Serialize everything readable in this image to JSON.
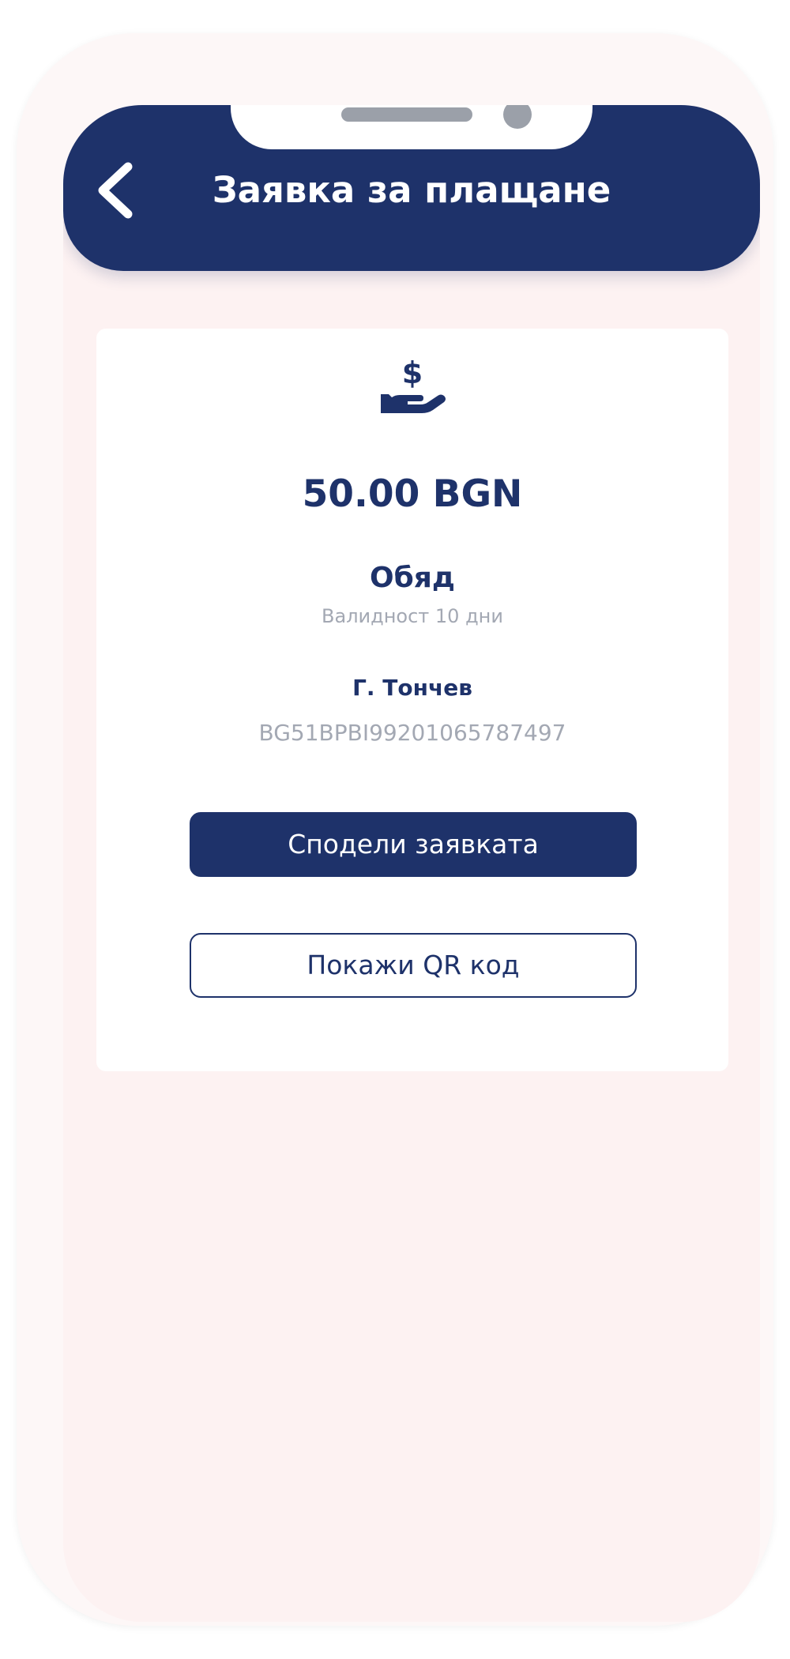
{
  "header": {
    "title": "Заявка за плащане",
    "back_icon": "chevron-left-icon"
  },
  "payment_request": {
    "icon": "hand-dollar-icon",
    "amount": "50.00 BGN",
    "purpose": "Обяд",
    "validity": "Валидност 10 дни",
    "recipient_name": "Г. Тончев",
    "recipient_iban": "BG51BPBI99201065787497"
  },
  "actions": {
    "share_label": "Сподели заявката",
    "qr_label": "Покажи QR код"
  },
  "colors": {
    "primary": "#1e326a",
    "muted_text": "#a3a8b3",
    "screen_background": "#fdf2f2",
    "card_background": "#ffffff"
  }
}
